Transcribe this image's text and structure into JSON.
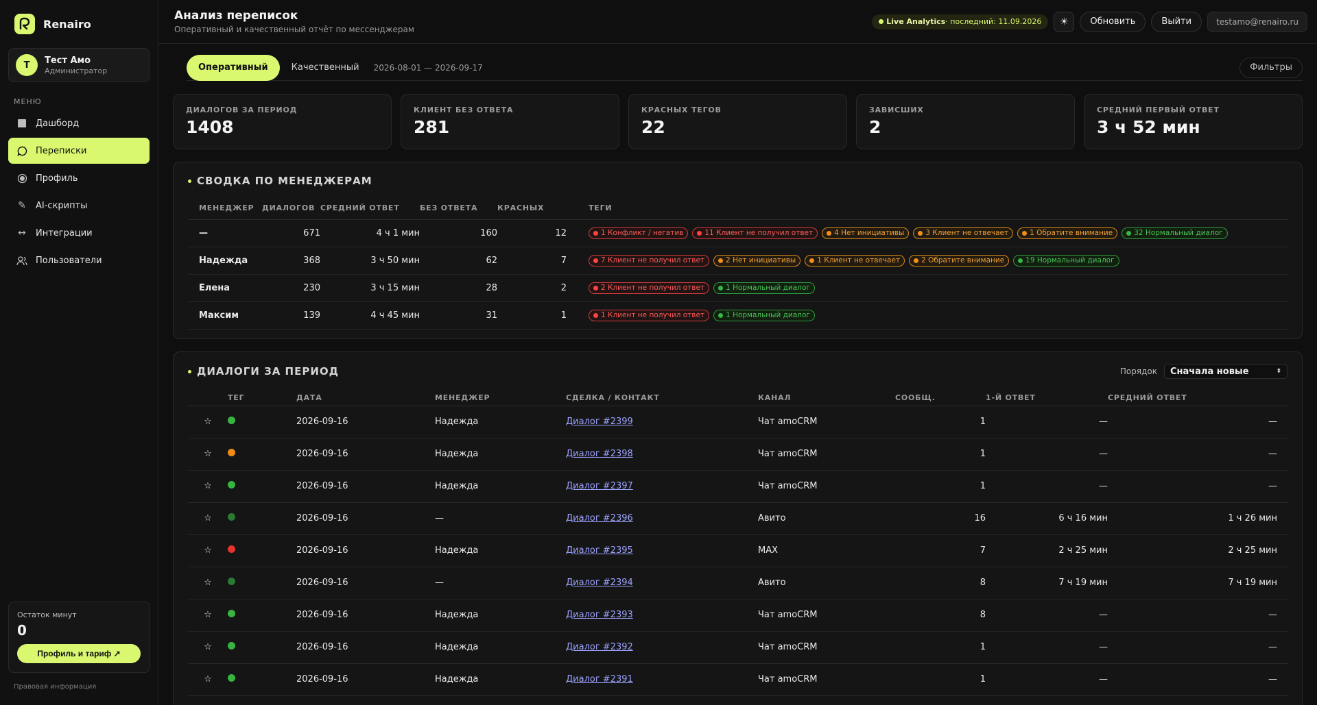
{
  "brand": {
    "name": "Renairo"
  },
  "user": {
    "initial": "Т",
    "name": "Тест Амо",
    "role": "Администратор"
  },
  "menu": {
    "title": "МЕНЮ",
    "items": [
      {
        "label": "Дашборд",
        "icon": "grid-icon"
      },
      {
        "label": "Переписки",
        "icon": "chat-icon",
        "active": true
      },
      {
        "label": "Профиль",
        "icon": "profile-icon"
      },
      {
        "label": "AI-скрипты",
        "icon": "pen-icon"
      },
      {
        "label": "Интеграции",
        "icon": "arrows-icon"
      },
      {
        "label": "Пользователи",
        "icon": "users-icon"
      }
    ]
  },
  "minutes": {
    "label": "Остаток минут",
    "value": "0",
    "button": "Профиль и тариф ↗"
  },
  "legal": "Правовая информация",
  "header": {
    "title": "Анализ переписок",
    "subtitle": "Оперативный и качественный отчёт по мессенджерам",
    "live_label": "Live Analytics",
    "live_last": " · последний: 11.09.2026",
    "theme_icon": "☀",
    "refresh": "Обновить",
    "logout": "Выйти",
    "email": "testamo@renairo.ru"
  },
  "tabs": {
    "operational": "Оперативный",
    "qualitative": "Качественный",
    "daterange": "2026-08-01 — 2026-09-17",
    "filters": "Фильтры"
  },
  "stats": [
    {
      "label": "ДИАЛОГОВ ЗА ПЕРИОД",
      "value": "1408"
    },
    {
      "label": "КЛИЕНТ БЕЗ ОТВЕТА",
      "value": "281"
    },
    {
      "label": "КРАСНЫХ ТЕГОВ",
      "value": "22"
    },
    {
      "label": "ЗАВИСШИХ",
      "value": "2"
    },
    {
      "label": "СРЕДНИЙ ПЕРВЫЙ ОТВЕТ",
      "value": "3 ч 52 мин"
    }
  ],
  "managers": {
    "title": "СВОДКА ПО МЕНЕДЖЕРАМ",
    "columns": [
      "МЕНЕДЖЕР",
      "ДИАЛОГОВ",
      "СРЕДНИЙ ОТВЕТ",
      "БЕЗ ОТВЕТА",
      "КРАСНЫХ",
      "ТЕГИ"
    ],
    "rows": [
      {
        "name": "—",
        "dialogs": "671",
        "avg": "4 ч 1 мин",
        "no_answer": "160",
        "red": "12",
        "tags": [
          {
            "text": "1 Конфликт / негатив",
            "color": "red"
          },
          {
            "text": "11 Клиент не получил ответ",
            "color": "red"
          },
          {
            "text": "4 Нет инициативы",
            "color": "orange"
          },
          {
            "text": "3 Клиент не отвечает",
            "color": "orange"
          },
          {
            "text": "1 Обратите внимание",
            "color": "orange"
          },
          {
            "text": "32 Нормальный диалог",
            "color": "green"
          }
        ]
      },
      {
        "name": "Надежда",
        "dialogs": "368",
        "avg": "3 ч 50 мин",
        "no_answer": "62",
        "red": "7",
        "tags": [
          {
            "text": "7 Клиент не получил ответ",
            "color": "red"
          },
          {
            "text": "2 Нет инициативы",
            "color": "orange"
          },
          {
            "text": "1 Клиент не отвечает",
            "color": "orange"
          },
          {
            "text": "2 Обратите внимание",
            "color": "orange"
          },
          {
            "text": "19 Нормальный диалог",
            "color": "green"
          }
        ]
      },
      {
        "name": "Елена",
        "dialogs": "230",
        "avg": "3 ч 15 мин",
        "no_answer": "28",
        "red": "2",
        "tags": [
          {
            "text": "2 Клиент не получил ответ",
            "color": "red"
          },
          {
            "text": "1 Нормальный диалог",
            "color": "green"
          }
        ]
      },
      {
        "name": "Максим",
        "dialogs": "139",
        "avg": "4 ч 45 мин",
        "no_answer": "31",
        "red": "1",
        "tags": [
          {
            "text": "1 Клиент не получил ответ",
            "color": "red"
          },
          {
            "text": "1 Нормальный диалог",
            "color": "green"
          }
        ]
      }
    ]
  },
  "dialogs": {
    "title": "ДИАЛОГИ ЗА ПЕРИОД",
    "order_label": "Порядок",
    "order_value": "Сначала новые",
    "columns": [
      "",
      "ТЕГ",
      "ДАТА",
      "МЕНЕДЖЕР",
      "СДЕЛКА / КОНТАКТ",
      "КАНАЛ",
      "СООБЩ.",
      "1-Й ОТВЕТ",
      "СРЕДНИЙ ОТВЕТ"
    ],
    "rows": [
      {
        "tag": "#36b53f",
        "date": "2026-09-16",
        "manager": "Надежда",
        "deal": "Диалог #2399",
        "channel": "Чат amoCRM",
        "msgs": "1",
        "first": "—",
        "avg": "—"
      },
      {
        "tag": "#f08a14",
        "date": "2026-09-16",
        "manager": "Надежда",
        "deal": "Диалог #2398",
        "channel": "Чат amoCRM",
        "msgs": "1",
        "first": "—",
        "avg": "—"
      },
      {
        "tag": "#36b53f",
        "date": "2026-09-16",
        "manager": "Надежда",
        "deal": "Диалог #2397",
        "channel": "Чат amoCRM",
        "msgs": "1",
        "first": "—",
        "avg": "—"
      },
      {
        "tag": "#2a7a33",
        "date": "2026-09-16",
        "manager": "—",
        "deal": "Диалог #2396",
        "channel": "Авито",
        "msgs": "16",
        "first": "6 ч 16 мин",
        "avg": "1 ч 26 мин"
      },
      {
        "tag": "#e8322f",
        "date": "2026-09-16",
        "manager": "Надежда",
        "deal": "Диалог #2395",
        "channel": "MAX",
        "msgs": "7",
        "first": "2 ч 25 мин",
        "avg": "2 ч 25 мин"
      },
      {
        "tag": "#2a7a33",
        "date": "2026-09-16",
        "manager": "—",
        "deal": "Диалог #2394",
        "channel": "Авито",
        "msgs": "8",
        "first": "7 ч 19 мин",
        "avg": "7 ч 19 мин"
      },
      {
        "tag": "#36b53f",
        "date": "2026-09-16",
        "manager": "Надежда",
        "deal": "Диалог #2393",
        "channel": "Чат amoCRM",
        "msgs": "8",
        "first": "—",
        "avg": "—"
      },
      {
        "tag": "#36b53f",
        "date": "2026-09-16",
        "manager": "Надежда",
        "deal": "Диалог #2392",
        "channel": "Чат amoCRM",
        "msgs": "1",
        "first": "—",
        "avg": "—"
      },
      {
        "tag": "#36b53f",
        "date": "2026-09-16",
        "manager": "Надежда",
        "deal": "Диалог #2391",
        "channel": "Чат amoCRM",
        "msgs": "1",
        "first": "—",
        "avg": "—"
      }
    ]
  }
}
